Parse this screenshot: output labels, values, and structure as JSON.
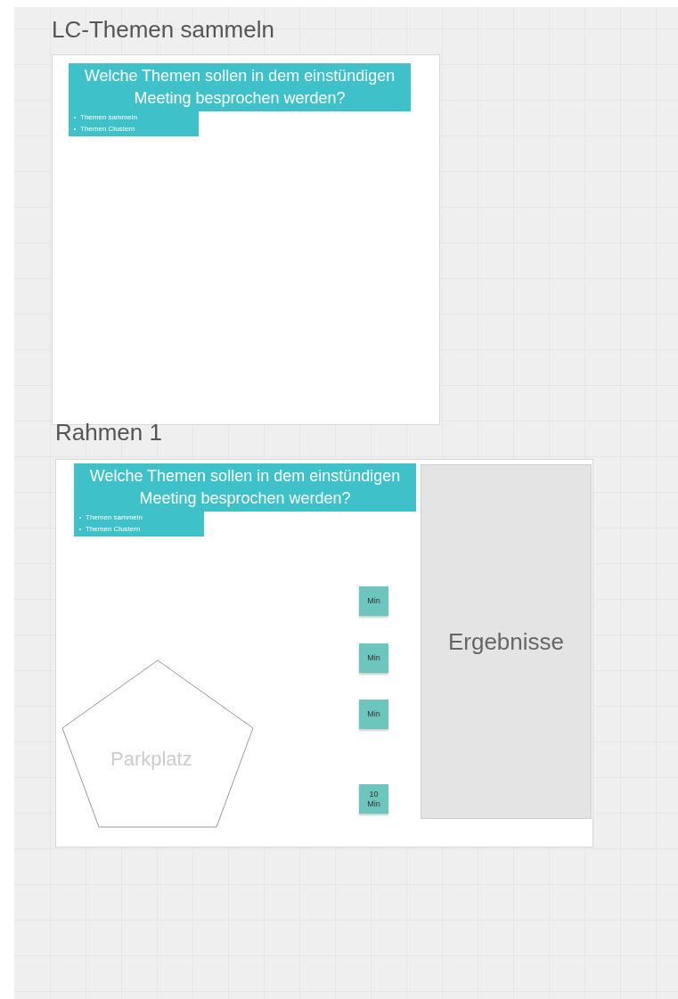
{
  "frames": [
    {
      "title": "LC-Themen sammeln",
      "heading": "Welche Themen sollen in dem einstündigen Meeting besprochen werden?",
      "bullets": [
        "Themen sammeln",
        "Themen Clustern"
      ]
    },
    {
      "title": "Rahmen 1",
      "heading": "Welche Themen sollen in dem einstündigen Meeting besprochen werden?",
      "bullets": [
        "Themen sammeln",
        "Themen Clustern"
      ],
      "stickies": [
        "Min",
        "Min",
        "Min",
        "10 Min"
      ],
      "results": "Ergebnisse",
      "parking": "Parkplatz"
    }
  ]
}
